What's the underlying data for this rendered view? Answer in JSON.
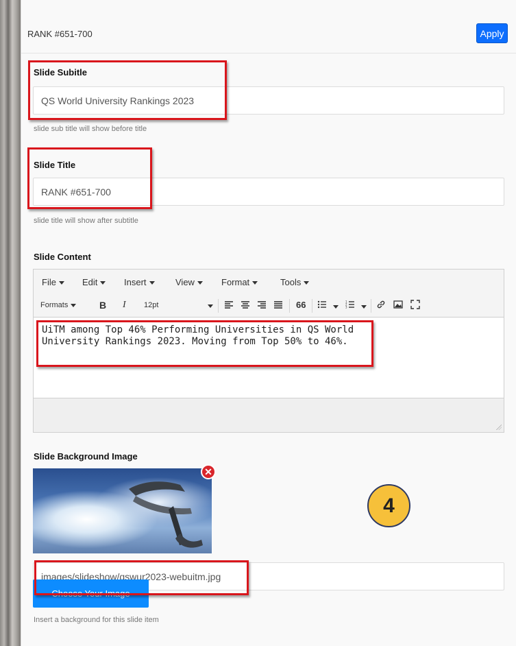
{
  "header": {
    "title": "RANK #651-700",
    "apply_label": "Apply"
  },
  "subtitle_field": {
    "label": "Slide Subitle",
    "value": "QS World University Rankings 2023",
    "help": "slide sub title will show before title"
  },
  "title_field": {
    "label": "Slide Title",
    "value": "RANK #651-700",
    "help": "slide title will show after subtitle"
  },
  "content_field": {
    "label": "Slide Content",
    "menus": [
      "File",
      "Edit",
      "Insert",
      "View",
      "Format",
      "Tools"
    ],
    "toolbar": {
      "formats": "Formats",
      "bold": "B",
      "italic": "I",
      "font_size": "12pt",
      "blockquote": "66"
    },
    "text_line1": "UiTM among Top 46% Performing Universities in QS World",
    "text_line2": "University Rankings 2023. Moving from Top 50% to 46%."
  },
  "background_field": {
    "label": "Slide Background Image",
    "remove_glyph": "✕",
    "path_value": "images/slideshow/qswur2023-webuitm.jpg",
    "choose_label": "Choose Your Image",
    "help": "Insert a background for this slide item"
  },
  "step_badge": "4",
  "colors": {
    "accent": "#0d6efd",
    "highlight": "#d9161c",
    "badge": "#f6c03a"
  }
}
